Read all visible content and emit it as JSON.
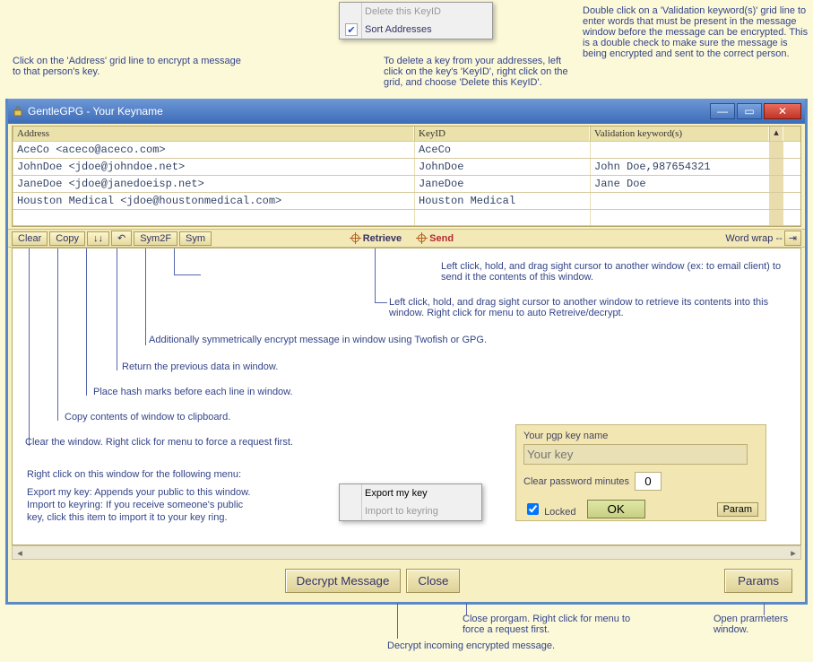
{
  "contextMenu": {
    "delete_label": "Delete this KeyID",
    "sort_label": "Sort Addresses"
  },
  "callouts": {
    "top_left": "Click on the 'Address' grid line to encrypt a message to that person's key.",
    "top_mid": "To delete a key from your addresses, left click on the key's 'KeyID', right click on the grid, and choose 'Delete this KeyID'.",
    "top_right": "Double click on a 'Validation keyword(s)' grid line to enter words that must be present in the message window before the message can be encrypted.  This is a double check to make sure the message is being encrypted and sent to the correct person.",
    "send1": "Left click, hold, and drag sight cursor to another window (ex: to email client) to send it the contents of this window.",
    "retrieve": "Left click, hold, and drag sight cursor to another window to retrieve its contents into this window.  Right click for menu to auto Retreive/decrypt.",
    "sym": "Additionally symmetrically encrypt message in window using Twofish or GPG.",
    "undo": "Return the previous data in window.",
    "hash": "Place hash marks before each line in window.",
    "copy": "Copy contents of window to clipboard.",
    "clear": "Clear the window.  Right click for menu to force a request first.",
    "rclick_heading": "Right click on this window for the following menu:",
    "exportline": "Export my key: Appends your public to this window.",
    "importline1": "Import to keyring: If you receive someone's public",
    "importline2": "key, click this item to import it to your key ring.",
    "decrypt": "Decrypt incoming encrypted message.",
    "close": "Close prorgam. Right click for menu to force a request first.",
    "params": "Open prarmeters window."
  },
  "window": {
    "title": "GentleGPG - Your Keyname",
    "grid": {
      "head": {
        "address": "Address",
        "keyid": "KeyID",
        "validation": "Validation keyword(s)"
      },
      "rows": [
        {
          "address": "AceCo <aceco@aceco.com>",
          "keyid": "AceCo",
          "validation": ""
        },
        {
          "address": "JohnDoe <jdoe@johndoe.net>",
          "keyid": "JohnDoe",
          "validation": "John Doe,987654321"
        },
        {
          "address": "JaneDoe <jdoe@janedoeisp.net>",
          "keyid": "JaneDoe",
          "validation": "Jane Doe"
        },
        {
          "address": "Houston Medical <jdoe@houstonmedical.com>",
          "keyid": "Houston Medical",
          "validation": ""
        }
      ]
    },
    "toolbar": {
      "clear": "Clear",
      "copy": "Copy",
      "hash": "↓↓",
      "undo": "↶",
      "sym2f": "Sym2F",
      "sym": "Sym",
      "retrieve": "Retrieve",
      "send": "Send",
      "wordwrap": "Word wrap --"
    },
    "panel": {
      "label_keyname": "Your pgp key name",
      "placeholder_keyname": "Your key",
      "label_clearpw": "Clear password minutes",
      "clearpw_value": "0",
      "locked": "Locked",
      "ok": "OK",
      "param": "Param"
    },
    "rclick_menu": {
      "export": "Export my key",
      "import": "Import to keyring"
    },
    "footer": {
      "decrypt": "Decrypt Message",
      "close": "Close",
      "params": "Params"
    }
  }
}
